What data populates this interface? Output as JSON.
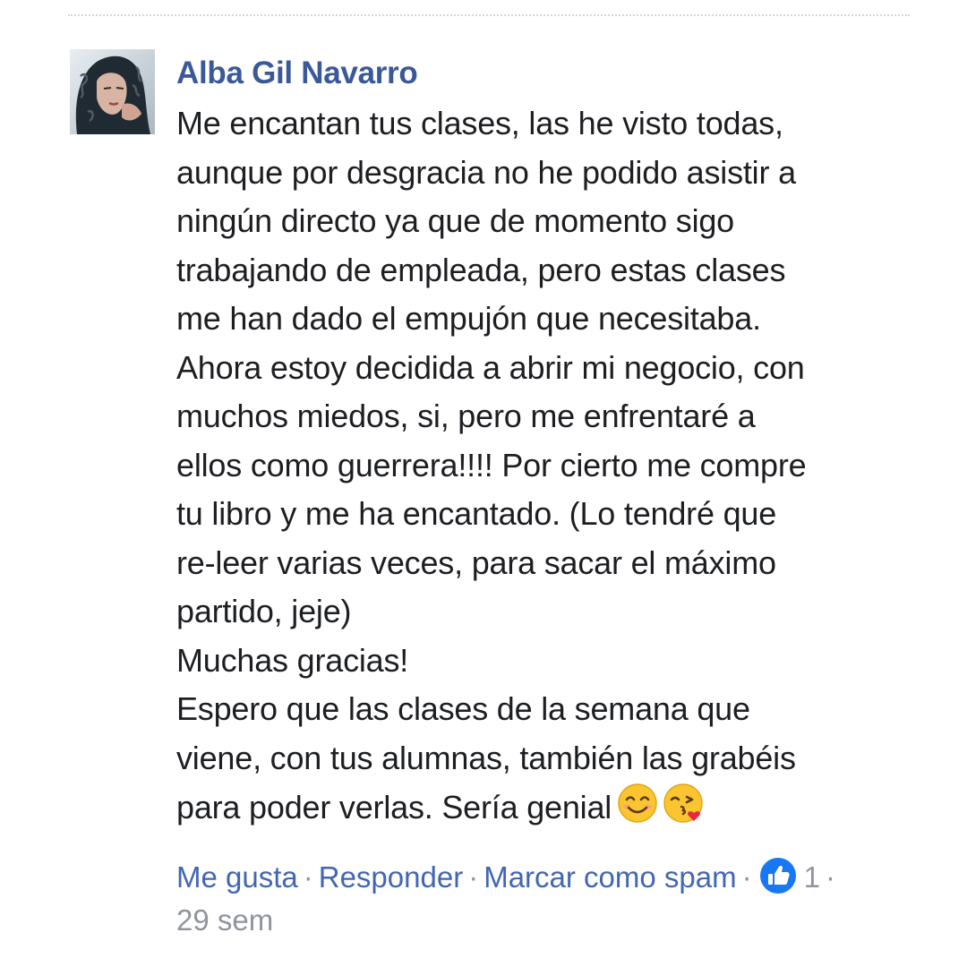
{
  "comment": {
    "author": "Alba Gil Navarro",
    "text_lines": [
      "Me encantan tus clases, las he visto todas,",
      "aunque por desgracia no he podido asistir a",
      "ningún directo ya que de momento sigo",
      "trabajando de empleada, pero estas clases",
      "me han dado el empujón que necesitaba.",
      "Ahora estoy decidida a abrir mi negocio, con",
      "muchos miedos, si, pero me enfrentaré a",
      "ellos como guerrera!!!! Por cierto me compre",
      "tu libro y me ha encantado. (Lo tendré que",
      "re-leer varias veces, para sacar el máximo",
      "partido, jeje)",
      "Muchas gracias!",
      "Espero que las clases de la semana que",
      "viene, con tus alumnas, también las grabéis",
      "para poder verlas. Sería genial"
    ],
    "emojis": [
      "smiling-face-with-smiling-eyes-icon",
      "face-blowing-kiss-icon"
    ],
    "actions": {
      "like_label": "Me gusta",
      "reply_label": "Responder",
      "spam_label": "Marcar como spam",
      "separator": "·",
      "reaction_icon": "like-thumb-icon",
      "like_count": "1"
    },
    "timestamp": "29 sem"
  },
  "colors": {
    "author": "#3b5998",
    "link": "#4267b2",
    "meta": "#90949c",
    "text": "#1c1e21",
    "like_badge": "#1877f2"
  }
}
